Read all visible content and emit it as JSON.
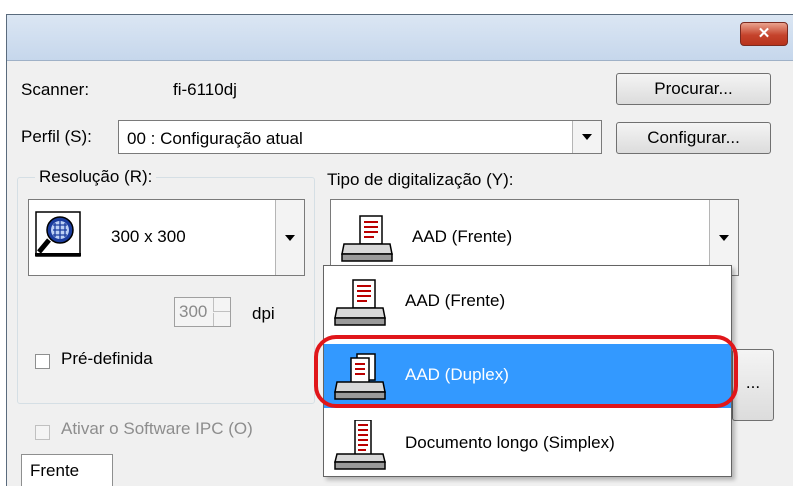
{
  "window": {
    "close_glyph": "✕"
  },
  "scanner": {
    "label": "Scanner:",
    "value": "fi-6110dj",
    "browse_button": "Procurar..."
  },
  "profile": {
    "label": "Perfil (S):",
    "value": "00 : Configuração atual",
    "configure_button": "Configurar..."
  },
  "resolution": {
    "group_label": "Resolução (R):",
    "selected": "300 x 300",
    "spin_value": "300",
    "unit": "dpi",
    "predefined_label": "Pré-definida",
    "predefined_checked": false
  },
  "scan_type": {
    "label": "Tipo de digitalização (Y):",
    "selected": "AAD (Frente)",
    "options": [
      {
        "label": "AAD (Frente)",
        "icon": "adf-front-icon",
        "selected": false
      },
      {
        "label": "AAD (Duplex)",
        "icon": "adf-duplex-icon",
        "selected": true
      },
      {
        "label": "Documento longo (Simplex)",
        "icon": "long-document-icon",
        "selected": false
      }
    ]
  },
  "ipc": {
    "label": "Ativar o Software IPC (O)",
    "enabled": false
  },
  "tabs": {
    "front": "Frente"
  },
  "side_button": {
    "label": "..."
  },
  "colors": {
    "highlight": "#e0161a",
    "selection": "#3399ff"
  }
}
